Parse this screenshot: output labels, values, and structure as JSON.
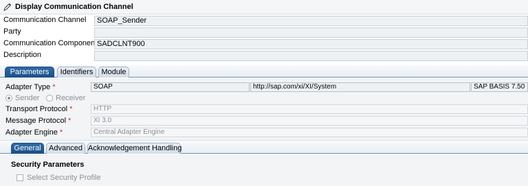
{
  "window": {
    "title": "Display Communication Channel"
  },
  "header_fields": [
    {
      "label": "Communication Channel",
      "value": "SOAP_Sender"
    },
    {
      "label": "Party",
      "value": ""
    },
    {
      "label": "Communication Component",
      "value": "SADCLNT900"
    },
    {
      "label": "Description",
      "value": ""
    }
  ],
  "tabs_main": [
    "Parameters",
    "Identifiers",
    "Module"
  ],
  "parameters": {
    "adapter_type_label": "Adapter Type",
    "adapter_type": "SOAP",
    "adapter_namespace": "http://sap.com/xi/XI/System",
    "adapter_swcv": "SAP BASIS 7.50",
    "direction_sender": "Sender",
    "direction_receiver": "Receiver",
    "transport_protocol_label": "Transport Protocol",
    "transport_protocol": "HTTP",
    "message_protocol_label": "Message Protocol",
    "message_protocol": "XI 3.0",
    "adapter_engine_label": "Adapter Engine",
    "adapter_engine": "Central Adapter Engine"
  },
  "tabs_sub": [
    "General",
    "Advanced",
    "Acknowledgement Handling"
  ],
  "general": {
    "security_title": "Security Parameters",
    "select_security_profile": "Select Security Profile"
  },
  "required_marker": "*"
}
